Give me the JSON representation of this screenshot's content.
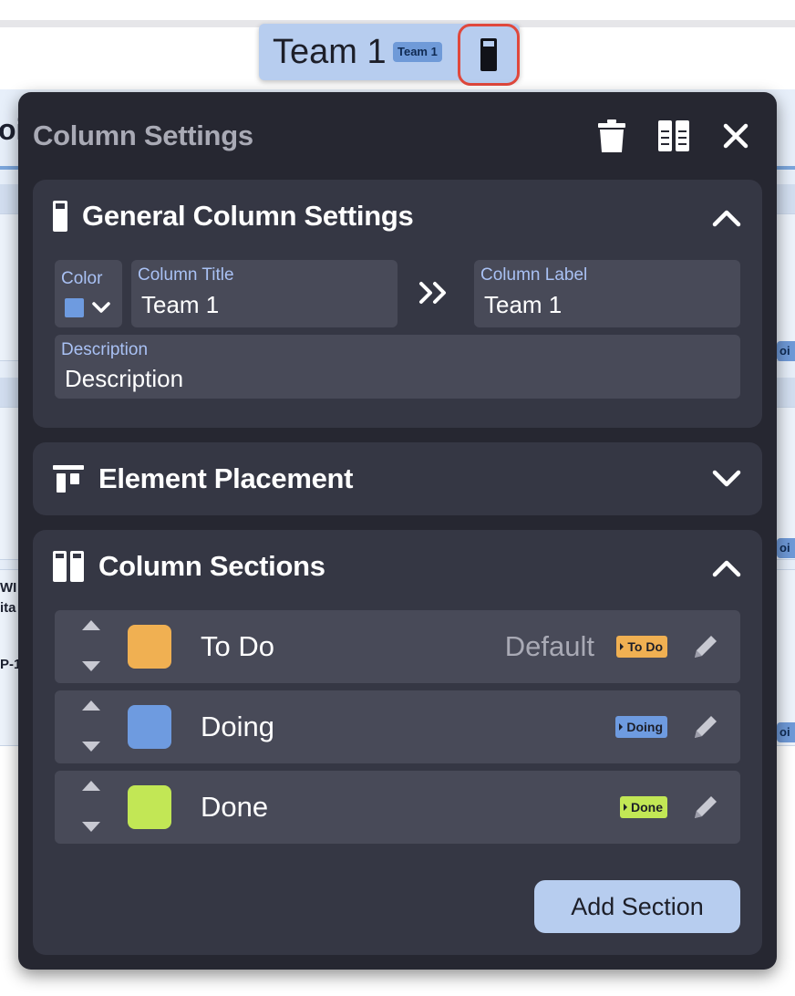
{
  "background": {
    "fragments": [
      "oi",
      "WI",
      "ita",
      "P-1"
    ],
    "badges": [
      "oi",
      "oi",
      "oi"
    ]
  },
  "column_header": {
    "title": "Team 1",
    "badge": "Team 1"
  },
  "modal": {
    "title": "Column Settings",
    "general": {
      "heading": "General Column Settings",
      "color_label": "Color",
      "color_value": "#6e9be0",
      "title_label": "Column Title",
      "title_value": "Team 1",
      "label_label": "Column Label",
      "label_value": "Team 1",
      "description_label": "Description",
      "description_value": "Description"
    },
    "placement": {
      "heading": "Element Placement"
    },
    "sections": {
      "heading": "Column Sections",
      "items": [
        {
          "name": "To Do",
          "default_text": "Default",
          "tag": "To Do",
          "color": "#f0b052"
        },
        {
          "name": "Doing",
          "default_text": "",
          "tag": "Doing",
          "color": "#6e9be0"
        },
        {
          "name": "Done",
          "default_text": "",
          "tag": "Done",
          "color": "#c2e755"
        }
      ],
      "add_button": "Add Section"
    }
  }
}
